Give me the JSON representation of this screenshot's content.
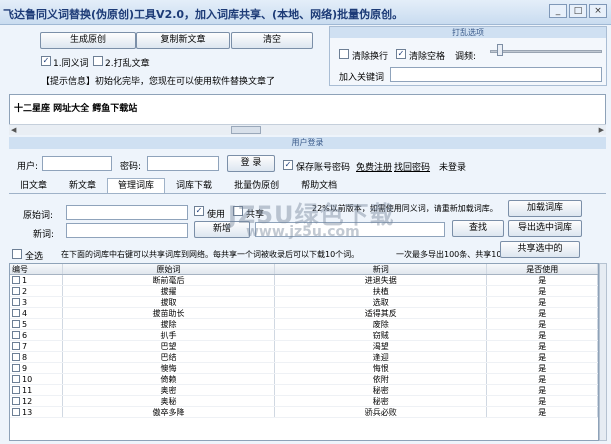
{
  "window": {
    "title": "飞达鲁同义词替换(伪原创)工具V2.0，加入词库共享、(本地、网络)批量伪原创。",
    "minimize": "_",
    "maximize": "□",
    "close": "×"
  },
  "toolbar": {
    "generate": "生成原创",
    "copy": "复制新文章",
    "clear": "清空",
    "synonym": "1.同义词",
    "shuffle": "2.打乱文章"
  },
  "info": "【提示信息】初始化完毕，您现在可以使用软件替换文章了",
  "shuffle_options": {
    "title": "打乱选项",
    "remove_newline": "清除换行",
    "remove_space": "清除空格",
    "frequency": "调频:",
    "keyword": "加入关键词"
  },
  "article_text": "十二星座  网址大全  鳄鱼下载站",
  "login": {
    "title": "用户登录",
    "user": "用户:",
    "password": "密码:",
    "login_button": "登 录",
    "save_password": "保存账号密码",
    "register": "免费注册",
    "recover": "找回密码",
    "status": "未登录"
  },
  "tabs": [
    "旧文章",
    "新文章",
    "管理词库",
    "词库下载",
    "批量伪原创",
    "帮助文档"
  ],
  "manage": {
    "original_word": "原始词:",
    "use": "使用",
    "shared": "共享",
    "notice_tail": "22%以前版本，如需使用同义词，请重新加载词库。",
    "load_lib": "加载词库",
    "new_word": "新词:",
    "add": "新增",
    "find": "查找",
    "export_selected": "导出选中词库",
    "select_all": "全选",
    "share_hint": "在下面的词库中右键可以共享词库到网络。每共享一个词被收录后可以下载10个词。",
    "limit_hint": "一次最多导出100条、共享10条。",
    "share_selected": "共享选中的"
  },
  "table": {
    "headers": [
      "编号",
      "原始词",
      "新词",
      "是否使用"
    ],
    "rows": [
      [
        "1",
        "断前毫后",
        "进退失据",
        "是"
      ],
      [
        "2",
        "拔擢",
        "扶植",
        "是"
      ],
      [
        "3",
        "拔取",
        "选取",
        "是"
      ],
      [
        "4",
        "拔苗助长",
        "适得其反",
        "是"
      ],
      [
        "5",
        "拔除",
        "废除",
        "是"
      ],
      [
        "6",
        "扒手",
        "窃贼",
        "是"
      ],
      [
        "7",
        "巴望",
        "渴望",
        "是"
      ],
      [
        "8",
        "巴结",
        "逢迎",
        "是"
      ],
      [
        "9",
        "懊悔",
        "悔恨",
        "是"
      ],
      [
        "10",
        "倚赖",
        "依附",
        "是"
      ],
      [
        "11",
        "奥密",
        "秘密",
        "是"
      ],
      [
        "12",
        "奥秘",
        "秘密",
        "是"
      ],
      [
        "13",
        "傲卒多降",
        "骄兵必败",
        "是"
      ]
    ]
  },
  "watermark": {
    "main": "JZ5U绿色下载",
    "sub": "www.jz5u.com"
  }
}
